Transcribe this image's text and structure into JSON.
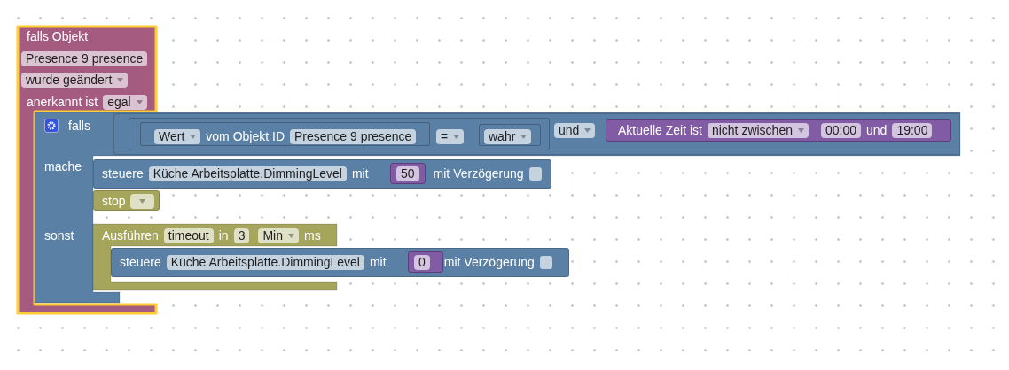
{
  "trigger": {
    "title": "falls Objekt",
    "object": "Presence 9 presence",
    "event": "wurde geändert",
    "ack_label": "anerkannt ist",
    "ack_value": "egal",
    "selected": true
  },
  "if_block": {
    "label": "falls",
    "do_label": "mache",
    "else_label": "sonst"
  },
  "condition": {
    "compare": {
      "property": "Wert",
      "label": "vom Objekt ID",
      "object": "Presence 9 presence",
      "operator": "=",
      "value": "wahr"
    },
    "logic_operator": "und",
    "time": {
      "label": "Aktuelle Zeit ist",
      "mode": "nicht zwischen",
      "start": "00:00",
      "joiner": "und",
      "end": "19:00"
    }
  },
  "do": [
    {
      "kind": "control",
      "verb": "steuere",
      "object": "Küche Arbeitsplatte.DimmingLevel",
      "with": "mit",
      "value": "50",
      "delay_label": "mit Verzögerung",
      "delay": false
    },
    {
      "kind": "stop",
      "label": "stop"
    }
  ],
  "else": {
    "label": "Ausführen",
    "name": "timeout",
    "in": "in",
    "amount": "3",
    "unit": "Min",
    "suffix": "ms",
    "body": {
      "kind": "control",
      "verb": "steuere",
      "object": "Küche Arbeitsplatte.DimmingLevel",
      "with": "mit",
      "value": "0",
      "delay_label": "mit Verzögerung",
      "delay": false
    }
  }
}
